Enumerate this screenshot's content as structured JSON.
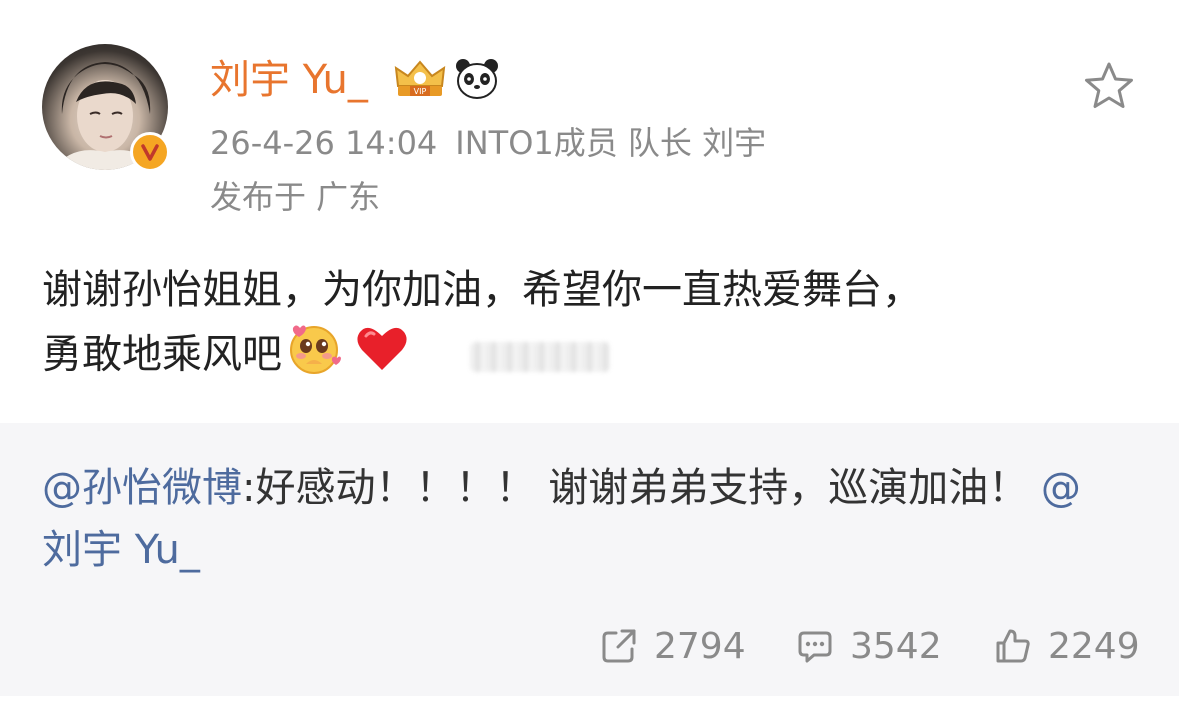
{
  "author": {
    "name": "刘宇 Yu_",
    "verified_badge": "v",
    "timestamp": "26-4-26 14:04",
    "description": "INTO1成员 队长 刘宇",
    "location": "发布于 广东"
  },
  "post": {
    "line1": "谢谢孙怡姐姐，为你加油，希望你一直热爱舞台，",
    "line2": "勇敢地乘风吧"
  },
  "repost": {
    "mention1": "@孙怡微博",
    "text": ":好感动！！！！ 谢谢弟弟支持，巡演加油！",
    "mention2_at": "@",
    "mention2_name": "刘宇 Yu_"
  },
  "actions": {
    "repost_count": "2794",
    "comment_count": "3542",
    "like_count": "2249"
  },
  "colors": {
    "username": "#e8752e",
    "mention": "#4e6b9e",
    "meta": "#8a8a8a",
    "repost_bg": "#f6f6f8"
  }
}
